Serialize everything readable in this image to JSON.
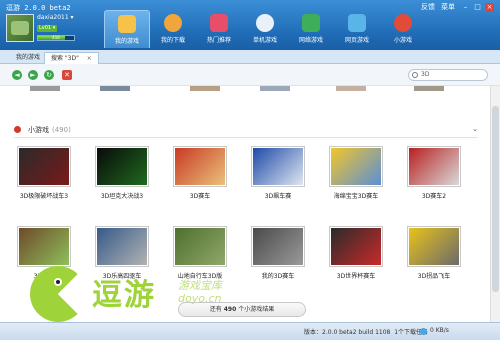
{
  "app": {
    "title": "逗游 2.0.0 beta2"
  },
  "window_links": {
    "feedback": "反馈",
    "menu": "菜单"
  },
  "user": {
    "name": "daxia2011 ▾",
    "level": "Lv01 ▾",
    "xp": "416"
  },
  "nav": [
    {
      "label": "我的游戏",
      "icon": "gamepad-icon",
      "color": "#f6c24a",
      "active": true
    },
    {
      "label": "我的下载",
      "icon": "download-gear-icon",
      "color": "#f0a63a",
      "active": false
    },
    {
      "label": "热门推荐",
      "icon": "hot-recommend-icon",
      "color": "#e64e6a",
      "active": false
    },
    {
      "label": "单机游戏",
      "icon": "controller-icon",
      "color": "#e9f1f8",
      "active": false
    },
    {
      "label": "网络游戏",
      "icon": "online-game-icon",
      "color": "#3fae5a",
      "active": false
    },
    {
      "label": "网页游戏",
      "icon": "web-game-icon",
      "color": "#59b5e8",
      "active": false
    },
    {
      "label": "小游戏",
      "icon": "joystick-icon",
      "color": "#e04b3a",
      "active": false
    }
  ],
  "tabs": [
    {
      "label": "我的游戏"
    },
    {
      "label": "搜索 \"3D\"",
      "close": "×"
    }
  ],
  "toolbar": {
    "back": "◄",
    "forward": "►",
    "refresh": "↻",
    "stop": "✕"
  },
  "search": {
    "value": "3D"
  },
  "section": {
    "title": "小游戏",
    "count": "(490)",
    "toggle": "⌄"
  },
  "games": [
    {
      "title": "3D极限破坏战车3",
      "colors": [
        "#2a2a2a",
        "#7a1a1a"
      ]
    },
    {
      "title": "3D坦克大决战3",
      "colors": [
        "#0a0a0a",
        "#1f6a1f"
      ]
    },
    {
      "title": "3D赛车",
      "colors": [
        "#c93a25",
        "#e9c17a"
      ]
    },
    {
      "title": "3D飙车赛",
      "colors": [
        "#1e4aa8",
        "#dfe6f0"
      ]
    },
    {
      "title": "海绵宝宝3D赛车",
      "colors": [
        "#f2c52b",
        "#5a8fd6"
      ]
    },
    {
      "title": "3D赛车2",
      "colors": [
        "#b82020",
        "#d9d9d9"
      ]
    },
    {
      "title": "3D骑马",
      "colors": [
        "#6e4a2a",
        "#8fbf5a"
      ]
    },
    {
      "title": "3D乐高四驱车",
      "colors": [
        "#355a8a",
        "#b2b2b2"
      ]
    },
    {
      "title": "山地自行车3D版",
      "colors": [
        "#4f6f2f",
        "#8fa86a"
      ]
    },
    {
      "title": "我的3D赛车",
      "colors": [
        "#4a4a4a",
        "#9a9a9a"
      ]
    },
    {
      "title": "3D世界杯赛车",
      "colors": [
        "#2b2b2b",
        "#c92a2a"
      ]
    },
    {
      "title": "3D拐品飞车",
      "colors": [
        "#e8c21a",
        "#6b6b6b"
      ]
    }
  ],
  "logo": {
    "name": "逗游",
    "sub": "游戏宝库",
    "url": "doyo.cn"
  },
  "more": {
    "prefix": "还有",
    "count": "490",
    "suffix": "个小游戏结果"
  },
  "status": {
    "version": "版本：2.0.0 beta2 build 1108",
    "downloads": "1个下载任务",
    "speed": "0 KB/s"
  }
}
